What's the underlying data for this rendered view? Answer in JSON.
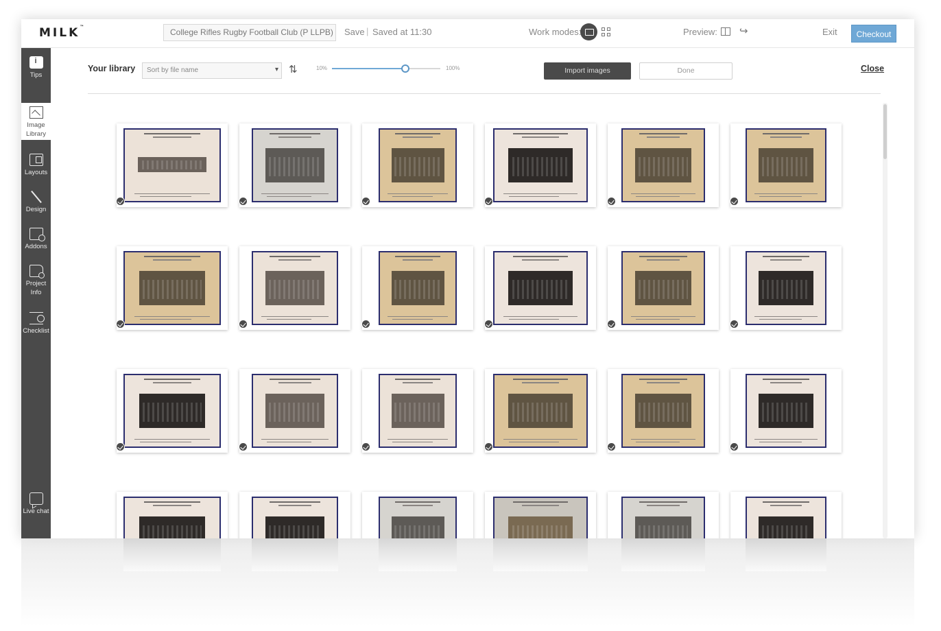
{
  "app": {
    "logo": "MILK",
    "logo_mark": "™"
  },
  "topbar": {
    "project_title": "College Rifles Rugby Football Club (P LLPB)",
    "save_label": "Save",
    "separator": "|",
    "saved_status": "Saved at 11:30",
    "work_modes_label": "Work modes:",
    "preview_label": "Preview:",
    "exit_label": "Exit",
    "checkout_label": "Checkout",
    "checkout_color": "#6fa8d6"
  },
  "sidebar": {
    "items": [
      {
        "label": "Tips",
        "icon": "tips-icon",
        "active": false
      },
      {
        "label": "Image Library",
        "icon": "image-icon",
        "active": true
      },
      {
        "label": "Layouts",
        "icon": "layouts-icon",
        "active": false
      },
      {
        "label": "Design",
        "icon": "design-icon",
        "active": false
      },
      {
        "label": "Addons",
        "icon": "addons-icon",
        "active": false
      },
      {
        "label": "Project Info",
        "icon": "project-info-icon",
        "active": false
      },
      {
        "label": "Checklist",
        "icon": "checklist-icon",
        "active": false
      }
    ],
    "live_chat_label": "Live chat"
  },
  "library": {
    "title": "Your library",
    "sort_value": "Sort by file name",
    "zoom_min_label": "10%",
    "zoom_max_label": "100%",
    "zoom_level": 0.68,
    "import_label": "Import images",
    "done_label": "Done",
    "close_label": "Close"
  },
  "images": [
    {
      "tone": "light-mount",
      "used": true
    },
    {
      "tone": "grey-mount",
      "used": true
    },
    {
      "tone": "sepia-mount",
      "used": true
    },
    {
      "tone": "light-mount-dark-photo",
      "used": true
    },
    {
      "tone": "sepia-mount",
      "used": true
    },
    {
      "tone": "sepia-mount",
      "used": true
    },
    {
      "tone": "sepia-mount",
      "used": true
    },
    {
      "tone": "light-mount",
      "used": true
    },
    {
      "tone": "sepia-mount",
      "used": true
    },
    {
      "tone": "light-mount-dark-photo",
      "used": true
    },
    {
      "tone": "sepia-mount",
      "used": true
    },
    {
      "tone": "light-mount-dark-photo",
      "used": true
    },
    {
      "tone": "light-mount-dark-photo",
      "used": true
    },
    {
      "tone": "light-mount",
      "used": true
    },
    {
      "tone": "light-mount",
      "used": true
    },
    {
      "tone": "sepia-mount",
      "used": true
    },
    {
      "tone": "sepia-mount",
      "used": true
    },
    {
      "tone": "light-mount-dark-photo",
      "used": true
    },
    {
      "tone": "light-mount-dark-photo",
      "used": false
    },
    {
      "tone": "light-mount-dark-photo",
      "used": false
    },
    {
      "tone": "grey-mount",
      "used": false
    },
    {
      "tone": "grey-mount-sepia-photo",
      "used": false
    },
    {
      "tone": "grey-mount",
      "used": false
    },
    {
      "tone": "light-mount-dark-photo",
      "used": false
    }
  ]
}
